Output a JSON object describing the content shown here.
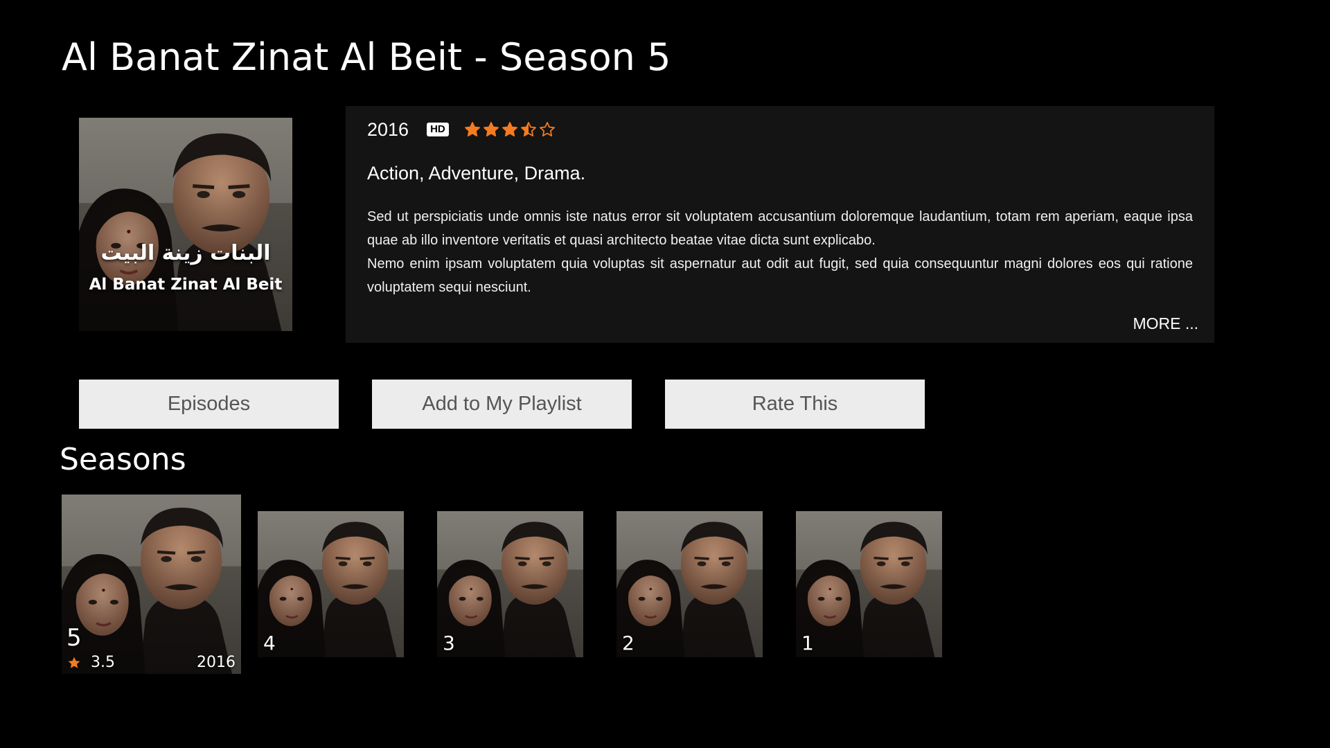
{
  "title": "Al Banat Zinat Al Beit - Season 5",
  "poster": {
    "arabic_title": "البنات زينة البيت",
    "english_title": "Al Banat Zinat Al Beit"
  },
  "info": {
    "year": "2016",
    "badge": "HD",
    "rating": 3.5,
    "rating_max": 5,
    "star_color": "#f47b20",
    "genres": "Action, Adventure, Drama.",
    "description_1": "Sed ut perspiciatis unde omnis iste natus error sit voluptatem accusantium doloremque laudantium, totam rem aperiam, eaque ipsa quae ab illo inventore veritatis et quasi architecto beatae vitae dicta sunt explicabo.",
    "description_2": "Nemo enim ipsam voluptatem quia voluptas sit aspernatur aut odit aut fugit, sed quia consequuntur magni dolores eos qui ratione voluptatem sequi nesciunt.",
    "more_label": "MORE ..."
  },
  "actions": {
    "episodes": "Episodes",
    "playlist": "Add to My Playlist",
    "rate": "Rate This"
  },
  "seasons": {
    "heading": "Seasons",
    "items": [
      {
        "number": "5",
        "rating": "3.5",
        "year": "2016",
        "selected": true
      },
      {
        "number": "4"
      },
      {
        "number": "3"
      },
      {
        "number": "2"
      },
      {
        "number": "1"
      }
    ]
  }
}
